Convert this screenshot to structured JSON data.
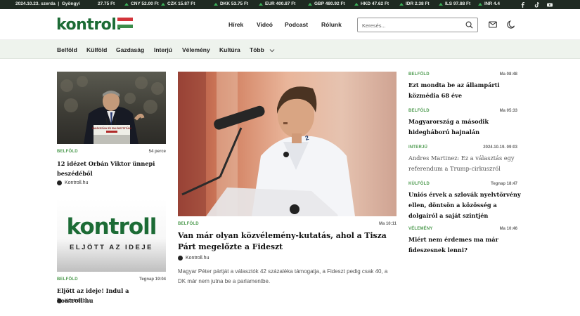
{
  "ticker": {
    "date": "2024.10.23. szerda",
    "separator": "|",
    "nameday": "Gyöngyi",
    "currencies": [
      {
        "text": "27.75 Ft",
        "dir": "up"
      },
      {
        "text": "CNY 52.00 Ft",
        "dir": "up"
      },
      {
        "text": "CZK 15.87 Ft",
        "dir": "up"
      },
      {
        "text": "DKK 53.75 Ft",
        "dir": "up"
      },
      {
        "text": "EUR 400.87 Ft",
        "dir": "up"
      },
      {
        "text": "GBP 480.92 Ft",
        "dir": "up"
      },
      {
        "text": "HKD 47.62 Ft",
        "dir": "up"
      },
      {
        "text": "IDR 2.38 Ft",
        "dir": "up"
      },
      {
        "text": "ILS 97.88 Ft",
        "dir": "up"
      },
      {
        "text": "INR 4.4",
        "dir": "up"
      }
    ],
    "social_icons": [
      "facebook-icon",
      "tiktok-icon",
      "youtube-icon"
    ]
  },
  "header": {
    "logo": "kontroll",
    "nav": [
      "Hírek",
      "Videó",
      "Podcast",
      "Rólunk"
    ],
    "search_placeholder": "Keresés...",
    "icons": [
      "search-icon",
      "mail-icon",
      "dark-mode-icon"
    ]
  },
  "categories": [
    "Belföld",
    "Külföld",
    "Gazdaság",
    "Interjú",
    "Vélemény",
    "Kultúra",
    "Több"
  ],
  "left_articles": [
    {
      "category": "BELFÖLD",
      "time": "54 perce",
      "title": "12 idézet Orbán Viktor ünnepi beszédéből",
      "author": "Kontroll.hu",
      "image_text": "EMLÉKEZÜNK ÉS EMLÉKEZTETÜNK"
    },
    {
      "category": "BELFÖLD",
      "time": "Tegnap 19:04",
      "title": "Eljött az ideje! Indul a kontroll.hu",
      "author": "Kontroll.hu",
      "image_logo": "kontroll",
      "image_tagline": "ELJÖTT AZ IDEJE"
    }
  ],
  "main_article": {
    "category": "BELFÖLD",
    "time": "Ma 10:11",
    "title": "Van már olyan közvélemény-kutatás, ahol a Tisza Párt megelőzte a Fideszt",
    "author": "Kontroll.hu",
    "excerpt": "Magyar Péter pártját a választók 42 százaléka támogatja, a Fideszt pedig csak 40, a DK már nem jutna be a parlamentbe."
  },
  "right_articles": [
    {
      "category": "BELFÖLD",
      "time": "Ma 08:48",
      "title": "Ezt mondta be az állampárti közmédia 68 éve"
    },
    {
      "category": "BELFÖLD",
      "time": "Ma 05:33",
      "title": "Magyarország a második hidegháború hajnalán"
    },
    {
      "category": "INTERJÚ",
      "time": "2024.10.19. 09:03",
      "title": "Andres Martinez: Ez a választás egy referendum a Trump-cirkuszról"
    },
    {
      "category": "KÜLFÖLD",
      "time": "Tegnap 18:47",
      "title": "Uniós érvek a szlovák nyelvtörvény ellen, döntsön a közösség a dolgairól a saját szintjén"
    },
    {
      "category": "VÉLEMÉNY",
      "time": "Ma 10:46",
      "title": "Miért nem érdemes ma már fideszesnek lenni?"
    }
  ],
  "colors": {
    "brand_green": "#1c6b35",
    "category_green": "#4c9a4e",
    "ticker_bg": "#1f2a22",
    "catnav_bg": "#eef3ed"
  }
}
